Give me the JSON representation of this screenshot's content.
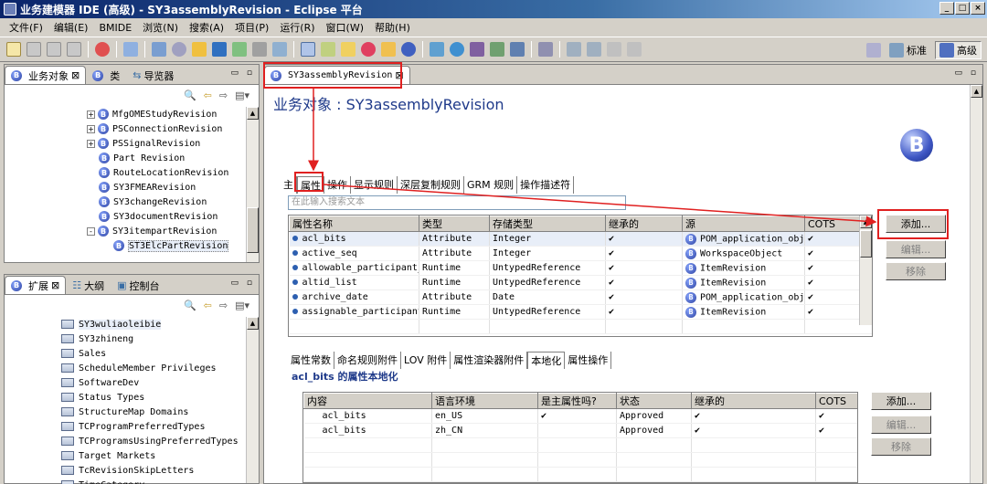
{
  "window": {
    "title": "业务建模器 IDE (高级) - SY3assemblyRevision - Eclipse 平台"
  },
  "menu": [
    "文件(F)",
    "编辑(E)",
    "BMIDE",
    "浏览(N)",
    "搜索(A)",
    "项目(P)",
    "运行(R)",
    "窗口(W)",
    "帮助(H)"
  ],
  "perspectives": {
    "standard": "标准",
    "advanced": "高级"
  },
  "left_top_panel": {
    "tabs": [
      "业务对象",
      "类",
      "导览器"
    ],
    "tree": [
      {
        "label": "MfgOMEStudyRevision",
        "expand": "+",
        "indent": 0
      },
      {
        "label": "PSConnectionRevision",
        "expand": "+",
        "indent": 0
      },
      {
        "label": "PSSignalRevision",
        "expand": "+",
        "indent": 0
      },
      {
        "label": "Part Revision",
        "expand": "",
        "indent": 0
      },
      {
        "label": "RouteLocationRevision",
        "expand": "",
        "indent": 0
      },
      {
        "label": "SY3FMEARevision",
        "expand": "",
        "indent": 0
      },
      {
        "label": "SY3changeRevision",
        "expand": "",
        "indent": 0
      },
      {
        "label": "SY3documentRevision",
        "expand": "",
        "indent": 0
      },
      {
        "label": "SY3itempartRevision",
        "expand": "-",
        "indent": 0
      },
      {
        "label": "ST3ElcPartRevision",
        "expand": "",
        "indent": 1
      }
    ]
  },
  "left_bottom_panel": {
    "tabs": [
      "扩展",
      "大纲",
      "控制台"
    ],
    "list": [
      "SY3wuliaoleibie",
      "SY3zhineng",
      "Sales",
      "ScheduleMember Privileges",
      "SoftwareDev",
      "Status Types",
      "StructureMap Domains",
      "TCProgramPreferredTypes",
      "TCProgramsUsingPreferredTypes",
      "Target Markets",
      "TcRevisionSkipLetters",
      "TimeCategory"
    ]
  },
  "editor": {
    "tab": "SY3assemblyRevision",
    "title": "业务对象 : SY3assemblyRevision",
    "tabs": [
      "主",
      "属性",
      "操作",
      "显示规则",
      "深层复制规则",
      "GRM 规则",
      "操作描述符"
    ],
    "active_tab": "属性",
    "search_placeholder": "在此输入搜索文本",
    "table": {
      "headers": [
        "属性名称",
        "类型",
        "存储类型",
        "继承的",
        "源",
        "COTS"
      ],
      "rows": [
        {
          "name": "acl_bits",
          "type": "Attribute",
          "storage": "Integer",
          "inherited": "✔",
          "source": "POM_application_obj",
          "cots": "✔"
        },
        {
          "name": "active_seq",
          "type": "Attribute",
          "storage": "Integer",
          "inherited": "✔",
          "source": "WorkspaceObject",
          "cots": "✔"
        },
        {
          "name": "allowable_participant_",
          "type": "Runtime",
          "storage": "UntypedReference",
          "inherited": "✔",
          "source": "ItemRevision",
          "cots": "✔"
        },
        {
          "name": "altid_list",
          "type": "Runtime",
          "storage": "UntypedReference",
          "inherited": "✔",
          "source": "ItemRevision",
          "cots": "✔"
        },
        {
          "name": "archive_date",
          "type": "Attribute",
          "storage": "Date",
          "inherited": "✔",
          "source": "POM_application_obj",
          "cots": "✔"
        },
        {
          "name": "assignable_participant",
          "type": "Runtime",
          "storage": "UntypedReference",
          "inherited": "✔",
          "source": "ItemRevision",
          "cots": "✔"
        }
      ]
    },
    "buttons": {
      "add": "添加...",
      "edit": "编辑...",
      "remove": "移除"
    },
    "sub_tabs": [
      "属性常数",
      "命名规则附件",
      "LOV 附件",
      "属性渲染器附件",
      "本地化",
      "属性操作"
    ],
    "active_sub_tab": "本地化",
    "loc_title": "acl_bits 的属性本地化",
    "loc_table": {
      "headers": [
        "内容",
        "语言环境",
        "是主属性吗?",
        "状态",
        "继承的",
        "COTS"
      ],
      "rows": [
        {
          "content": "acl_bits",
          "locale": "en_US",
          "master": "✔",
          "status": "Approved",
          "inherited": "✔",
          "cots": "✔"
        },
        {
          "content": "acl_bits",
          "locale": "zh_CN",
          "master": "",
          "status": "Approved",
          "inherited": "✔",
          "cots": "✔"
        }
      ]
    }
  },
  "colors": {
    "highlight": "#e02020",
    "title_bar": "#0a246a",
    "accent": "#1f3a8a"
  }
}
